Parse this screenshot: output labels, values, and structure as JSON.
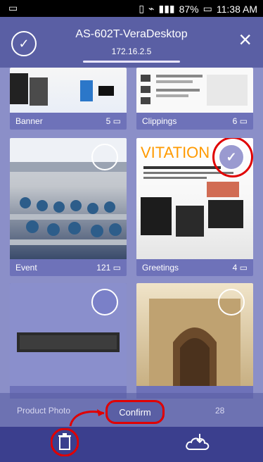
{
  "statusbar": {
    "battery": "87%",
    "time": "11:38 AM"
  },
  "app": {
    "title": "AS-602T-VeraDesktop",
    "subtitle": "172.16.2.5"
  },
  "albums": [
    {
      "label": "Banner",
      "count": "5"
    },
    {
      "label": "Clippings",
      "count": "6"
    },
    {
      "label": "Event",
      "count": "121"
    },
    {
      "label": "Greetings",
      "count": "4"
    },
    {
      "label": "Product Photo",
      "count": ""
    },
    {
      "label": "",
      "count": "28"
    }
  ],
  "actions": {
    "confirm": "Confirm"
  },
  "colors": {
    "appbar": "#5a5fa4",
    "accent": "#e00000"
  }
}
